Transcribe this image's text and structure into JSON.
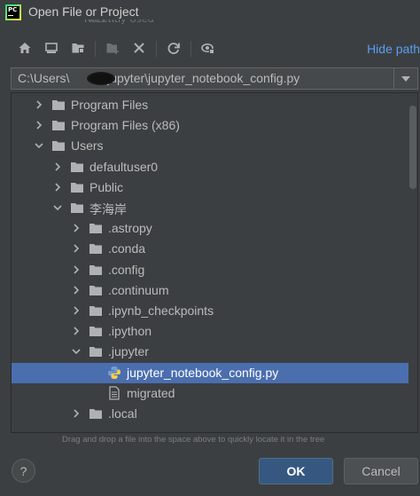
{
  "window": {
    "title": "Open File or Project",
    "app_icon_text": "PC",
    "behind_text": "Recently Used Files ..."
  },
  "toolbar": {
    "buttons": [
      "home-icon",
      "desktop-icon",
      "project-folder-icon",
      "new-folder-icon",
      "delete-icon",
      "refresh-icon",
      "show-hidden-icon"
    ],
    "hide_path_label": "Hide path"
  },
  "path": {
    "prefix": "C:\\Users\\",
    "suffix": "\\.jupyter\\jupyter_notebook_config.py"
  },
  "tree": {
    "items": [
      {
        "label": "Program Files",
        "level": 1,
        "expanded": false
      },
      {
        "label": "Program Files (x86)",
        "level": 1,
        "expanded": false
      },
      {
        "label": "Users",
        "level": 1,
        "expanded": true
      },
      {
        "label": "defaultuser0",
        "level": 2,
        "expanded": false
      },
      {
        "label": "Public",
        "level": 2,
        "expanded": false
      },
      {
        "label": "李海岸",
        "level": 2,
        "expanded": true
      },
      {
        "label": ".astropy",
        "level": 3,
        "expanded": false
      },
      {
        "label": ".conda",
        "level": 3,
        "expanded": false
      },
      {
        "label": ".config",
        "level": 3,
        "expanded": false
      },
      {
        "label": ".continuum",
        "level": 3,
        "expanded": false
      },
      {
        "label": ".ipynb_checkpoints",
        "level": 3,
        "expanded": false
      },
      {
        "label": ".ipython",
        "level": 3,
        "expanded": false
      },
      {
        "label": ".jupyter",
        "level": 3,
        "expanded": true
      },
      {
        "label": "jupyter_notebook_config.py",
        "level": 4,
        "kind": "python-file",
        "selected": true
      },
      {
        "label": "migrated",
        "level": 4,
        "kind": "file"
      },
      {
        "label": ".local",
        "level": 3,
        "expanded": false
      }
    ]
  },
  "hint": "Drag and drop a file into the space above to quickly locate it in the tree",
  "footer": {
    "help_label": "?",
    "ok_label": "OK",
    "cancel_label": "Cancel"
  },
  "colors": {
    "background": "#3c3f41",
    "selection": "#4b6eaf",
    "link": "#589df6",
    "primary_button": "#365880"
  }
}
